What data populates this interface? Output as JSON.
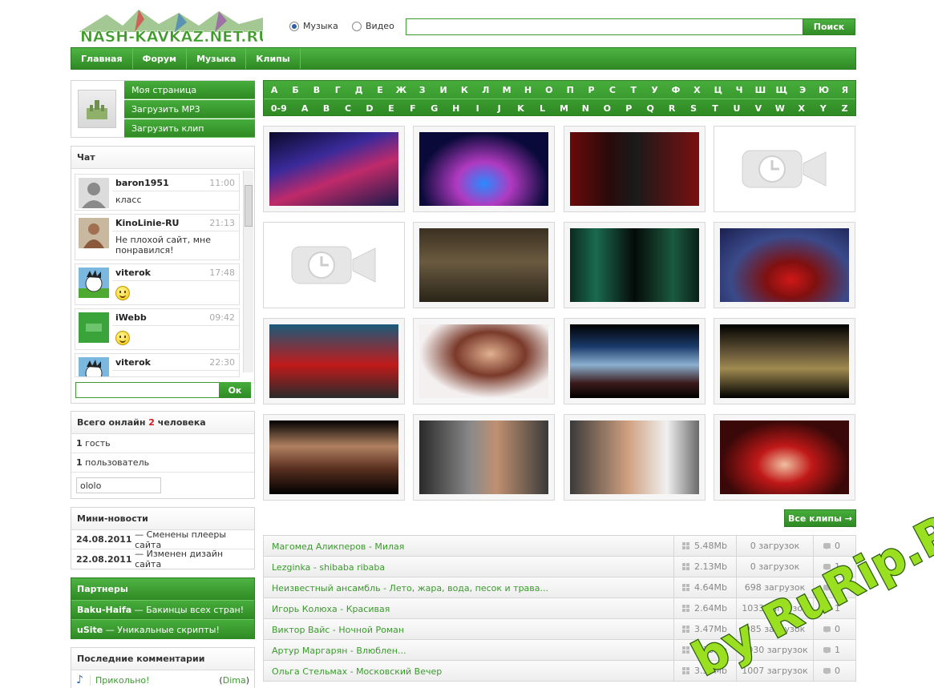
{
  "site": {
    "logo_text": "NASH-KAVKAZ.NET.RU"
  },
  "search": {
    "radio_music": "Музыка",
    "radio_video": "Видео",
    "button": "Поиск",
    "value": ""
  },
  "nav": [
    "Главная",
    "Форум",
    "Музыка",
    "Клипы"
  ],
  "user_menu": [
    "Моя страница",
    "Загрузить MP3",
    "Загрузить клип"
  ],
  "chat": {
    "title": "Чат",
    "messages": [
      {
        "nick": "baron1951",
        "time": "11:00",
        "text": "класс"
      },
      {
        "nick": "KinoLinie-RU",
        "time": "21:13",
        "text": "Не плохой сайт, мне понравился!"
      },
      {
        "nick": "viterok",
        "time": "17:48",
        "text": ""
      },
      {
        "nick": "iWebb",
        "time": "09:42",
        "text": ""
      },
      {
        "nick": "viterok",
        "time": "22:30",
        "text": ""
      }
    ],
    "ok": "Ок"
  },
  "online": {
    "prefix": "Всего онлайн",
    "count": "2",
    "suffix": "человека",
    "guests_n": "1",
    "guests_label": "гость",
    "users_n": "1",
    "users_label": "пользователь",
    "user_name": "ololo"
  },
  "news": {
    "title": "Мини-новости",
    "items": [
      {
        "date": "24.08.2011",
        "text": "— Сменены плееры сайта"
      },
      {
        "date": "22.08.2011",
        "text": "— Изменен дизайн сайта"
      }
    ]
  },
  "partners": {
    "title": "Партнеры",
    "items": [
      {
        "name": "Baku-Haifa",
        "text": "— Бакинцы всех стран!"
      },
      {
        "name": "uSite",
        "text": "— Уникальные скрипты!"
      }
    ]
  },
  "comments": {
    "title": "Последние комментарии",
    "items": [
      {
        "text": "Прикольно!",
        "author": "Dima"
      }
    ]
  },
  "alphabet": {
    "row1": [
      "А",
      "Б",
      "В",
      "Г",
      "Д",
      "Е",
      "Ж",
      "З",
      "И",
      "К",
      "Л",
      "М",
      "Н",
      "О",
      "П",
      "Р",
      "С",
      "Т",
      "У",
      "Ф",
      "Х",
      "Ц",
      "Ч",
      "Ш",
      "Щ",
      "Э",
      "Ю",
      "Я"
    ],
    "row2": [
      "0-9",
      "A",
      "B",
      "C",
      "D",
      "E",
      "F",
      "G",
      "H",
      "I",
      "J",
      "K",
      "L",
      "M",
      "N",
      "O",
      "P",
      "Q",
      "R",
      "S",
      "T",
      "U",
      "V",
      "W",
      "X",
      "Y",
      "Z"
    ]
  },
  "clips": {
    "all_button": "Все клипы →"
  },
  "tracks": [
    {
      "title": "Магомед Аликперов - Милая",
      "size": "5.48Mb",
      "downloads": "0 загрузок",
      "comments": "0"
    },
    {
      "title": "Lezginka - shibaba ribaba",
      "size": "2.13Mb",
      "downloads": "0 загрузок",
      "comments": "1"
    },
    {
      "title": "Неизвестный ансамбль - Лето, жара, вода, песок и трава...",
      "size": "4.64Mb",
      "downloads": "698 загрузок",
      "comments": "0"
    },
    {
      "title": "Игорь Колюха - Красивая",
      "size": "2.64Mb",
      "downloads": "1033 загрузок",
      "comments": "1"
    },
    {
      "title": "Виктор Вайс - Ночной Роман",
      "size": "3.47Mb",
      "downloads": "985 загрузок",
      "comments": "0"
    },
    {
      "title": "Артур Маргарян - Влюблен...",
      "size": "3.33Mb",
      "downloads": "1030 загрузок",
      "comments": "1"
    },
    {
      "title": "Ольга Стельмах - Московский Вечер",
      "size": "3.57Mb",
      "downloads": "1007 загрузок",
      "comments": "0"
    }
  ],
  "watermark": "by RuRip.Ru"
}
